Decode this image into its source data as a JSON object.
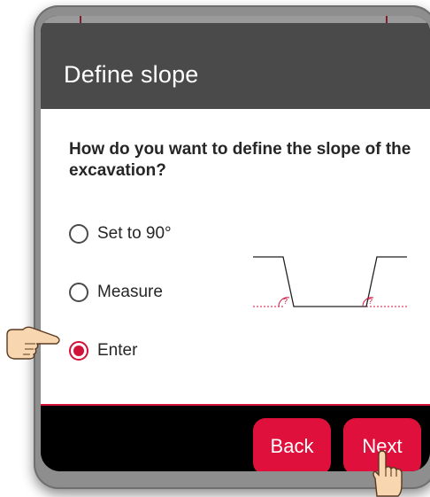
{
  "dialog": {
    "title": "Define slope",
    "question": "How do you want to define the slope of the excavation?"
  },
  "options": [
    {
      "label": "Set to 90°",
      "selected": false
    },
    {
      "label": "Measure",
      "selected": false
    },
    {
      "label": "Enter",
      "selected": true
    }
  ],
  "diagram": {
    "angle_marker": "?"
  },
  "buttons": {
    "back": "Back",
    "next": "Next"
  },
  "colors": {
    "accent": "#e0103c",
    "header": "#4a4a4a",
    "footer": "#000000",
    "device_frame": "#8e8e8e"
  },
  "icons": {
    "pointing_hand": "pointing-hand-icon",
    "tap_hand": "tap-hand-icon"
  }
}
